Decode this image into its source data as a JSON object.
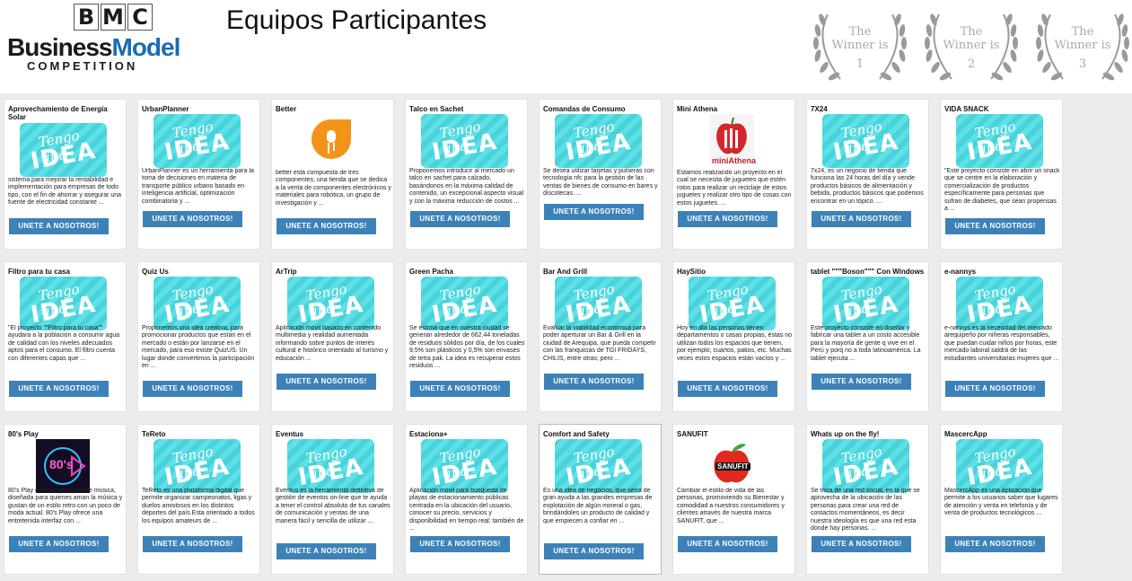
{
  "header": {
    "logo": {
      "bmc": [
        "B",
        "M",
        "C"
      ],
      "line1": "Business",
      "line2": "Model",
      "line3": "COMPETITION"
    },
    "title": "Equipos Participantes",
    "winners": [
      {
        "line1": "The",
        "line2": "Winner is",
        "rank": "1"
      },
      {
        "line1": "The",
        "line2": "Winner is",
        "rank": "2"
      },
      {
        "line1": "The",
        "line2": "Winner is",
        "rank": "3"
      }
    ]
  },
  "colors": {
    "button": "#3c82b8",
    "idea": "#48d3db",
    "page_bg": "#ececec"
  },
  "idea_text": {
    "line1": "Tengo una",
    "line2": "IDEA"
  },
  "cards": [
    {
      "title": "Aprovechamiento de Energía Solar",
      "image": "idea",
      "desc": "sistema para mejorar la rentabilidad e implementación para empresas de todo tipo, con el fin de ahorrar y asegurar una fuente de electricidad constante ...",
      "button": "UNETE A NOSOTROS!"
    },
    {
      "title": "UrbanPlanner",
      "image": "idea",
      "desc": "UrbanPlanner es un herramienta para la toma de decisiones en materia de transporte público urbano basado en inteligencia artificial, optimización combinatoria y ...",
      "button": "UNETE A NOSOTROS!"
    },
    {
      "title": "Better",
      "image": "better-logo",
      "desc": "better está compuesta de tres componentes; una tienda que se dedica a la venta de componentes electrónicos y materiales para robótica, un grupo de investigación y ...",
      "button": "UNETE A NOSOTROS!"
    },
    {
      "title": "Talco en Sachet",
      "image": "idea",
      "desc": "Proponemos introducir al mercado un talco en sachet para calzado, basándonos en la máxima calidad de contenido, un excepcional aspecto visual y con la máxima reducción de costos ...",
      "button": "UNETE A NOSOTROS!"
    },
    {
      "title": "Comandas de Consumo",
      "image": "idea",
      "desc": "Se desea utilizar tarjetas y pulseras con tecnología nfc para la gestión de las ventas de bienes de consumo en bares y discotecas. ...",
      "button": "UNETE A NOSOTROS!"
    },
    {
      "title": "Mini Athena",
      "image": "mini-athena-logo",
      "imgtext": "miniAthena",
      "desc": "Estamos realizando un proyecto en el cual se necesita de juguetes que estén rotos para realizar un reciclaje de estos juguetes y realizar otro tipo de cosas con estos juguetes. ...",
      "button": "UNETE A NOSOTROS!"
    },
    {
      "title": "7X24",
      "image": "idea",
      "desc": "7x24, es un negocio de tienda que funciona las 24 horas del día y vende productos básicos de alimentación y bebida, productos básicos que podemos encontrar en un tópico. ...",
      "button": "UNETE A NOSOTROS!"
    },
    {
      "title": "VIDA SNACK",
      "image": "idea",
      "desc": "\"Este proyecto consiste en abrir un snack que se centre en la elaboración y comercialización de productos específicamente para personas que sufran de diabetes, que sean propensas a ...",
      "button": "UNETE A NOSOTROS!"
    },
    {
      "title": "Filtro para tu casa",
      "image": "idea",
      "desc": "\"El proyecto \"\"Filtro para tu casa\"\" ayudara a la población a consumir agua de calidad con los niveles adecuados aptos para el consumo. El filtro cuenta con diferentes capas que ...",
      "button": "UNETE A NOSOTROS!"
    },
    {
      "title": "Quiz Us",
      "image": "idea",
      "desc": "Proponemos una idea creativa, para promocionar productos que están en el mercado o están por lanzarse en el mercado, para eso existe QuizUS. Un lugar donde convertimos la participación en ...",
      "button": "UNETE A NOSOTROS!"
    },
    {
      "title": "ArTrip",
      "image": "idea",
      "desc": "Aplicación móvil basado en contenido multimedia y realidad aumentada informando sobre puntos de interés cultural e histórico orientado al turismo y educación ...",
      "button": "UNETE A NOSOTROS!"
    },
    {
      "title": "Green Pacha",
      "image": "idea",
      "desc": "Se estima que en nuestra ciudad se generan alrededor de 662.44 toneladas de residuos sólidos por día, de los cuales 9.5% son plásticos y 0,5% son envases de tetra pak. La idea es recuperar estos residuos ...",
      "button": "UNETE A NOSOTROS!"
    },
    {
      "title": "Bar And Grill",
      "image": "idea",
      "desc": "Evaluar la viabilidad económica para poder aperturar un Bar & Grill en la ciudad de Arequipa, que pueda competir con las franquicias de TGI FRIDAYS, CHILIS, entre otras; pero ...",
      "button": "UNETE A NOSOTROS!"
    },
    {
      "title": "HaySitio",
      "image": "idea",
      "desc": "Hoy en día las personas tienen departamentos o casas propias, éstas no utilizan todos los espacios que tienen, por ejemplo; cuartos, patios, etc. Muchas veces estos espacios están vacíos y ...",
      "button": "UNETE A NOSOTROS!"
    },
    {
      "title": "tablet \"\"\"Boson\"\"\" Con Windows",
      "image": "idea",
      "desc": "Este proyecto consiste en diseñar y fabricar una tablet a un costo accesible para la mayoría de gente q vive en el Perú y porq no a toda latinoamérica. La tablet ejecuta ...",
      "button": "UNETE A NOSOTROS!"
    },
    {
      "title": "e-nannys",
      "image": "idea",
      "desc": "e-nannys es la necesidad del mercado arequipeño por niñeras responsables, que puedan cuidar niños por horas, este mercado laboral saldrá de las estudiantes universitarias mujeres que ...",
      "button": "UNETE A NOSOTROS!"
    },
    {
      "title": "80's Play",
      "image": "eighties-logo",
      "imgtext": "80's",
      "desc": "80's Play es una aplicación de música, diseñada para quienes aman la música y gustan de un estilo retro con un poco de moda actual. 80's Play ofrece una entretenida interfaz con ...",
      "button": "UNETE A NOSOTROS!"
    },
    {
      "title": "TeReto",
      "image": "idea",
      "desc": "TeReto es una plataforma digital que permite organizar campeonatos, ligas y duelos amistosos en los distintos deportes del país.Esta orientado a todos los equipos amateurs de ...",
      "button": "UNETE A NOSOTROS!"
    },
    {
      "title": "Eventus",
      "image": "idea",
      "desc": "Eventus es la herramienta definitiva de gestión de eventos on-line que te ayuda a tener el control absoluto de tus canales de comunicación y ventas de una manera fácil y sencilla de utilizar ...",
      "button": "UNETE A NOSOTROS!"
    },
    {
      "title": "Estaciona+",
      "image": "idea",
      "desc": "Aplicación móvil para búsqueda de playas de estacionamiento públicas centrada en la ubicación del usuario, conocer su precio, servicios y disponibilidad en tiempo real; también de ...",
      "button": "UNETE A NOSOTROS!"
    },
    {
      "title": "Comfort and Safety",
      "image": "idea",
      "desc": "Es una idea de negocios, que sería de gran ayuda a las grandes empresas de explotación de algún mineral o gas, brindándoles un producto de calidad y que empiecen a confiar en ...",
      "button": "UNETE A NOSOTROS!"
    },
    {
      "title": "SANUFIT",
      "image": "sanufit-logo",
      "imgtext": "SANUFIT",
      "desc": "Cambiar el estilo de vida de las personas, promoviendo su Bienestar y comodidad a nuestros consumidores y clientes através de nuestra marca SANUFIT, que ...",
      "button": "UNETE A NOSOTROS!"
    },
    {
      "title": "Whats up on the fly!",
      "image": "idea",
      "desc": "Se trata de una red social, en la que se aprovecha de la ubicación de las personas para crear una red de contactos momentáneos, es decir nuestra ideología es que una red esta donde hay personas. ...",
      "button": "UNETE A NOSOTROS!"
    },
    {
      "title": "MascercApp",
      "image": "idea",
      "desc": "MascercApp es una aplicación que permite a los usuarios saber que lugares de atención y venta en telefonía y de venta de productos tecnológicos ...",
      "button": "UNETE A NOSOTROS!"
    }
  ]
}
